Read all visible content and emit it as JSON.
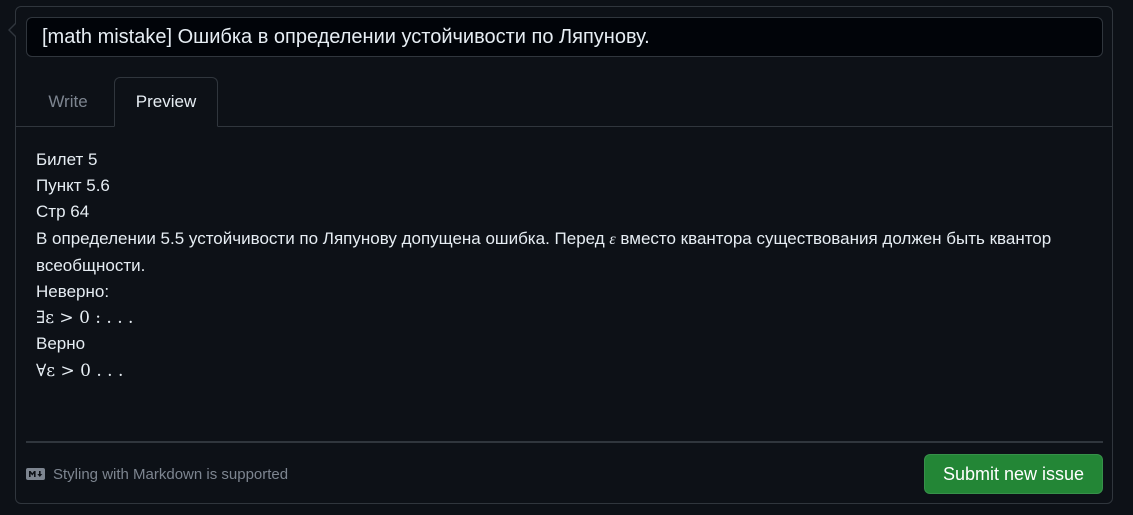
{
  "title_input": {
    "value": "[math mistake] Ошибка в определении устойчивости по Ляпунову."
  },
  "tabs": [
    {
      "label": "Write",
      "active": false
    },
    {
      "label": "Preview",
      "active": true
    }
  ],
  "preview": {
    "line1": "Билет 5",
    "line2": "Пункт 5.6",
    "line3": "Стр 64",
    "paragraph_before": "В определении 5.5 устойчивости по Ляпунову допущена ошибка. Перед ",
    "paragraph_epsilon": "ε",
    "paragraph_after": " вместо квантора существования должен быть квантор всеобщности.",
    "wrong_label": "Неверно:",
    "wrong_formula": "∃ε > 0 : . . .",
    "right_label": "Верно",
    "right_formula": "∀ε > 0 . . ."
  },
  "footer": {
    "markdown_note": "Styling with Markdown is supported",
    "markdown_icon": "markdown-icon",
    "submit_label": "Submit new issue"
  },
  "colors": {
    "background": "#0d1117",
    "border": "#30363d",
    "text": "#e6edf3",
    "muted": "#7d8590",
    "submit": "#238636"
  }
}
